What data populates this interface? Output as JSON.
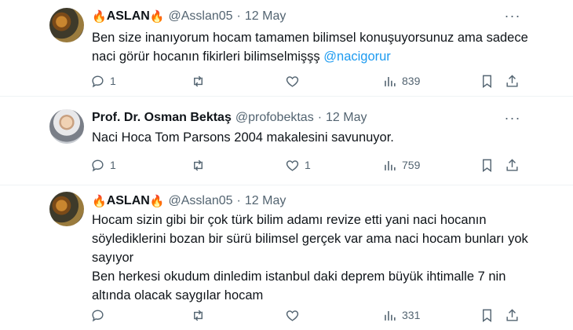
{
  "tweets": [
    {
      "name": "ASLAN",
      "flame_left": "🔥",
      "flame_right": "🔥",
      "handle": "@Asslan05",
      "separator": "·",
      "date": "12 May",
      "more": "···",
      "text_main": "Ben size inanıyorum hocam tamamen bilimsel konuşuyorsunuz ama sadece naci görür hocanın fikirleri bilimselmişşş ",
      "mention": "@nacigorur",
      "replies": "1",
      "retweets": "",
      "likes": "",
      "views": "839"
    },
    {
      "name": "Prof. Dr. Osman Bektaş",
      "handle": "@profobektas",
      "separator": "·",
      "date": "12 May",
      "more": "···",
      "text_main": "Naci Hoca Tom Parsons 2004 makalesini savunuyor.",
      "replies": "1",
      "retweets": "",
      "likes": "1",
      "views": "759"
    },
    {
      "name": "ASLAN",
      "flame_left": "🔥",
      "flame_right": "🔥",
      "handle": "@Asslan05",
      "separator": "·",
      "date": "12 May",
      "text_main": "Hocam sizin gibi bir çok türk bilim adamı revize etti yani naci hocanın söylediklerini bozan bir sürü bilimsel gerçek var ama naci hocam bunları yok sayıyor",
      "text_second": "Ben herkesi okudum dinledim istanbul daki deprem büyük ihtimalle 7 nin altında olacak saygılar hocam",
      "replies": "",
      "retweets": "",
      "likes": "",
      "views": "331"
    }
  ],
  "icons": {
    "reply": "reply-icon",
    "retweet": "retweet-icon",
    "like": "heart-icon",
    "views": "views-chart-icon",
    "bookmark": "bookmark-icon",
    "share": "share-icon",
    "more": "more-icon"
  },
  "colors": {
    "text": "#0f1419",
    "secondary": "#536471",
    "link": "#1d9bf0",
    "divider": "#eff3f4",
    "flame": "#f5a623"
  }
}
